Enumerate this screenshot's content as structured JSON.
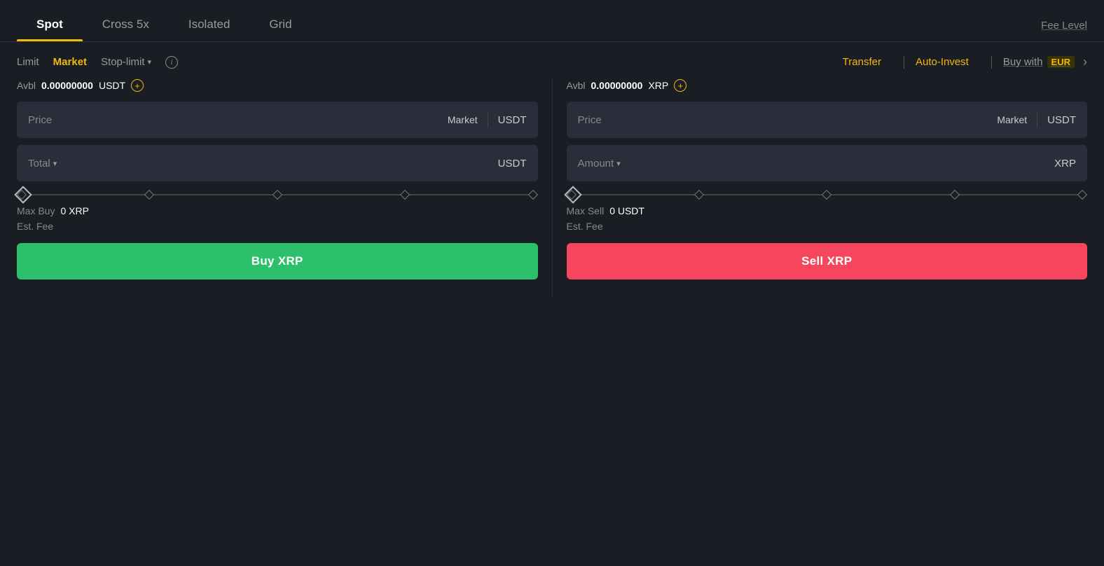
{
  "tabs": [
    {
      "id": "spot",
      "label": "Spot",
      "active": true
    },
    {
      "id": "cross5x",
      "label": "Cross 5x",
      "active": false
    },
    {
      "id": "isolated",
      "label": "Isolated",
      "active": false
    },
    {
      "id": "grid",
      "label": "Grid",
      "active": false
    }
  ],
  "fee_level_label": "Fee Level",
  "order_types": [
    {
      "id": "limit",
      "label": "Limit",
      "active": false
    },
    {
      "id": "market",
      "label": "Market",
      "active": true
    },
    {
      "id": "stop_limit",
      "label": "Stop-limit",
      "active": false
    }
  ],
  "info_icon_label": "i",
  "transfer_label": "Transfer",
  "auto_invest_label": "Auto-Invest",
  "buy_with_label": "Buy with",
  "buy_with_currency": "EUR",
  "buy_panel": {
    "avbl_label": "Avbl",
    "avbl_value": "0.00000000",
    "avbl_currency": "USDT",
    "price_placeholder": "Price",
    "price_tag": "Market",
    "price_currency": "USDT",
    "total_label": "Total",
    "total_currency": "USDT",
    "max_buy_label": "Max Buy",
    "max_buy_value": "0 XRP",
    "est_fee_label": "Est. Fee",
    "est_fee_value": "",
    "buy_button_label": "Buy XRP"
  },
  "sell_panel": {
    "avbl_label": "Avbl",
    "avbl_value": "0.00000000",
    "avbl_currency": "XRP",
    "price_placeholder": "Price",
    "price_tag": "Market",
    "price_currency": "USDT",
    "amount_label": "Amount",
    "amount_currency": "XRP",
    "max_sell_label": "Max Sell",
    "max_sell_value": "0 USDT",
    "est_fee_label": "Est. Fee",
    "est_fee_value": "",
    "sell_button_label": "Sell XRP"
  },
  "colors": {
    "accent": "#f0b90b",
    "buy": "#2dc06b",
    "sell": "#f6465d",
    "bg": "#1a1d24",
    "panel_bg": "#2b2e3a"
  }
}
